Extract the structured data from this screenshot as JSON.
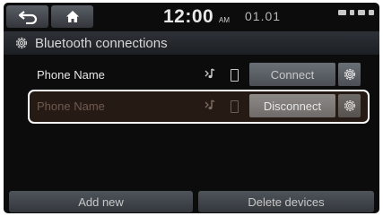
{
  "topbar": {
    "time": "12:00",
    "ampm": "AM",
    "date": "01.01",
    "back_icon": "back-arrow-icon",
    "home_icon": "home-icon"
  },
  "header": {
    "title": "Bluetooth connections",
    "icon": "gear-icon"
  },
  "devices": [
    {
      "name": "Phone Name",
      "action": "Connect",
      "selected": false
    },
    {
      "name": "Phone Name",
      "action": "Disconnect",
      "selected": true
    }
  ],
  "footer": {
    "add_label": "Add new",
    "delete_label": "Delete devices"
  },
  "colors": {
    "background": "#0c0c0c",
    "highlight_frame": "#ffffff",
    "text": "#d6d6d6"
  }
}
